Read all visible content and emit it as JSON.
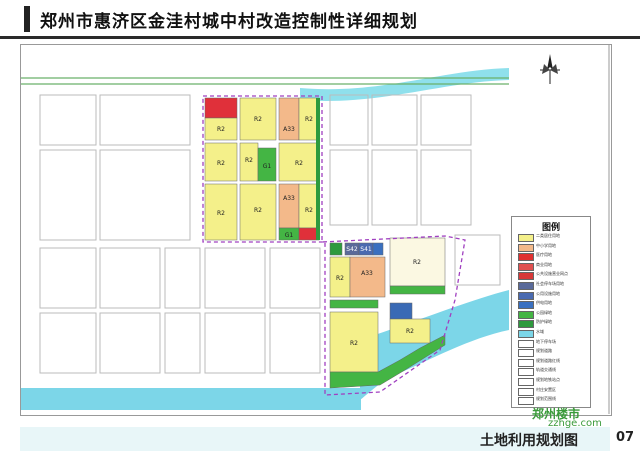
{
  "title": "郑州市惠济区金洼村城中村改造控制性详细规划",
  "legend": {
    "title": "图例",
    "items": [
      {
        "label": "二类居住用地",
        "color": "#f4f08a"
      },
      {
        "label": "中小学用地",
        "color": "#f3b98a"
      },
      {
        "label": "医疗用地",
        "color": "#e03030"
      },
      {
        "label": "商业用地",
        "color": "#e05050"
      },
      {
        "label": "公共设施营业网点",
        "color": "#d83838"
      },
      {
        "label": "社会停车场用地",
        "color": "#5a6a9a"
      },
      {
        "label": "公用设施用地",
        "color": "#4a6ab0"
      },
      {
        "label": "供电用地",
        "color": "#3a70c0"
      },
      {
        "label": "公园绿地",
        "color": "#44b544"
      },
      {
        "label": "防护绿地",
        "color": "#2e9a3e"
      },
      {
        "label": "水域",
        "color": "#7cd6e8"
      },
      {
        "label": "地下停车场",
        "color": "#ffffff"
      },
      {
        "label": "规划道路",
        "color": "#ffffff"
      },
      {
        "label": "规划道路红线",
        "color": "#ffffff"
      },
      {
        "label": "轨道交通线",
        "color": "#ffffff"
      },
      {
        "label": "规划地铁站点",
        "color": "#ffffff"
      },
      {
        "label": "村庄安置区",
        "color": "#ffffff"
      },
      {
        "label": "规划范围线",
        "color": "#ffffff"
      }
    ]
  },
  "parcels": {
    "r2": "R2",
    "a33": "A33",
    "g1": "G1",
    "r": "R",
    "s42": "S42",
    "s41": "S41"
  },
  "sheet_name": "土地利用规划图",
  "sheet_number": "07",
  "watermark": "郑州楼市",
  "watermark_url": "zzhge.com"
}
